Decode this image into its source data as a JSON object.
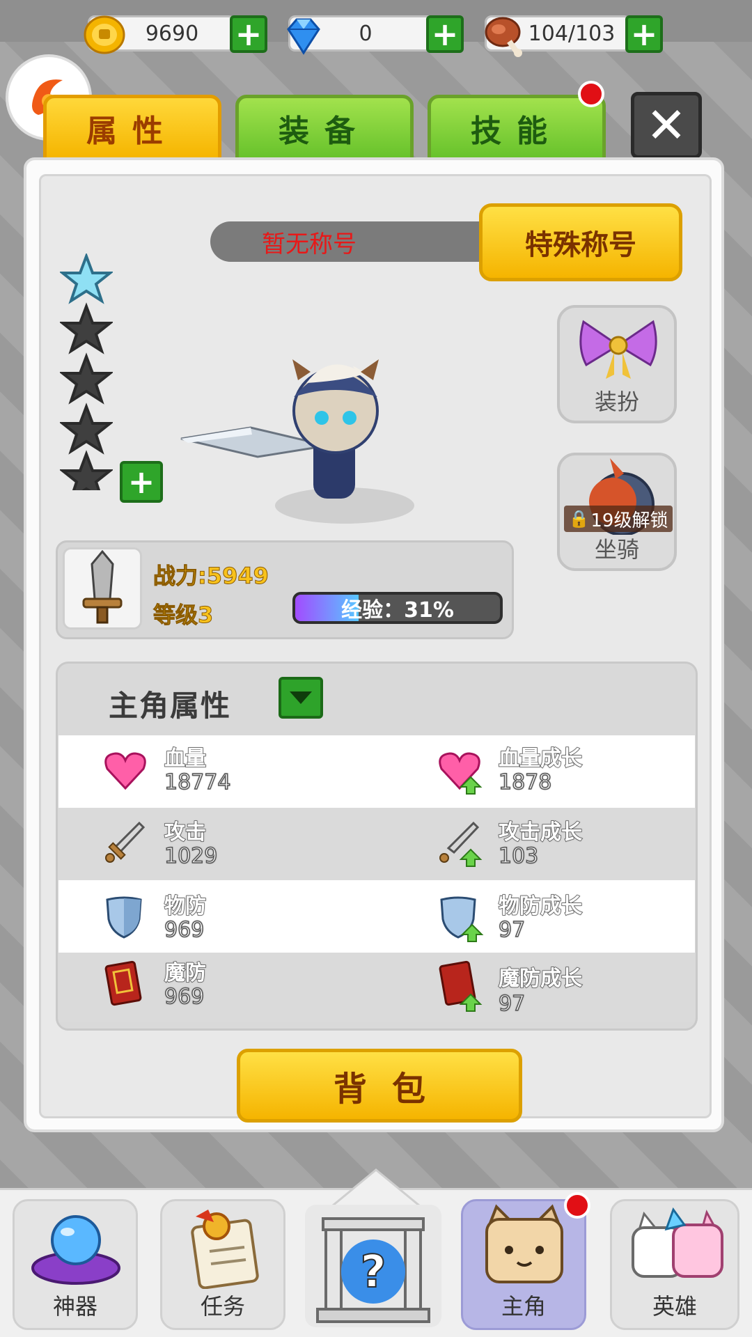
{
  "resources": {
    "gold": "9690",
    "diamond": "0",
    "stamina": "104/103"
  },
  "tabs": [
    {
      "label": "属性",
      "active": true
    },
    {
      "label": "装备",
      "active": false
    },
    {
      "label": "技能",
      "active": false,
      "notification": true
    }
  ],
  "close_label": "✕",
  "title": {
    "current": "暂无称号",
    "special_button": "特殊称号"
  },
  "stars": {
    "filled": 1,
    "total": 5
  },
  "side_buttons": {
    "outfit": "装扮",
    "mount": "坐骑",
    "mount_lock": "19级解锁"
  },
  "character": {
    "power_label": "战力:5949",
    "level_label": "等级3",
    "exp_label": "经验：31%",
    "exp_fraction": 0.31
  },
  "attributes": {
    "title": "主角属性",
    "rows": [
      {
        "left_name": "血量",
        "left_value": "18774",
        "right_name": "血量成长",
        "right_value": "1878"
      },
      {
        "left_name": "攻击",
        "left_value": "1029",
        "right_name": "攻击成长",
        "right_value": "103"
      },
      {
        "left_name": "物防",
        "left_value": "969",
        "right_name": "物防成长",
        "right_value": "97"
      },
      {
        "left_name": "魔防",
        "left_value": "969",
        "right_name": "魔防成长",
        "right_value": "97"
      }
    ]
  },
  "bag_button": "背包",
  "nav": [
    {
      "label": "神器"
    },
    {
      "label": "任务"
    },
    {
      "label": "主角",
      "active": true,
      "notification": true
    },
    {
      "label": "英雄"
    }
  ],
  "colors": {
    "tab_active": "#f5b500",
    "tab_inactive": "#67c22b",
    "title_text": "#e81818",
    "gold_text": "#f8c21c"
  }
}
